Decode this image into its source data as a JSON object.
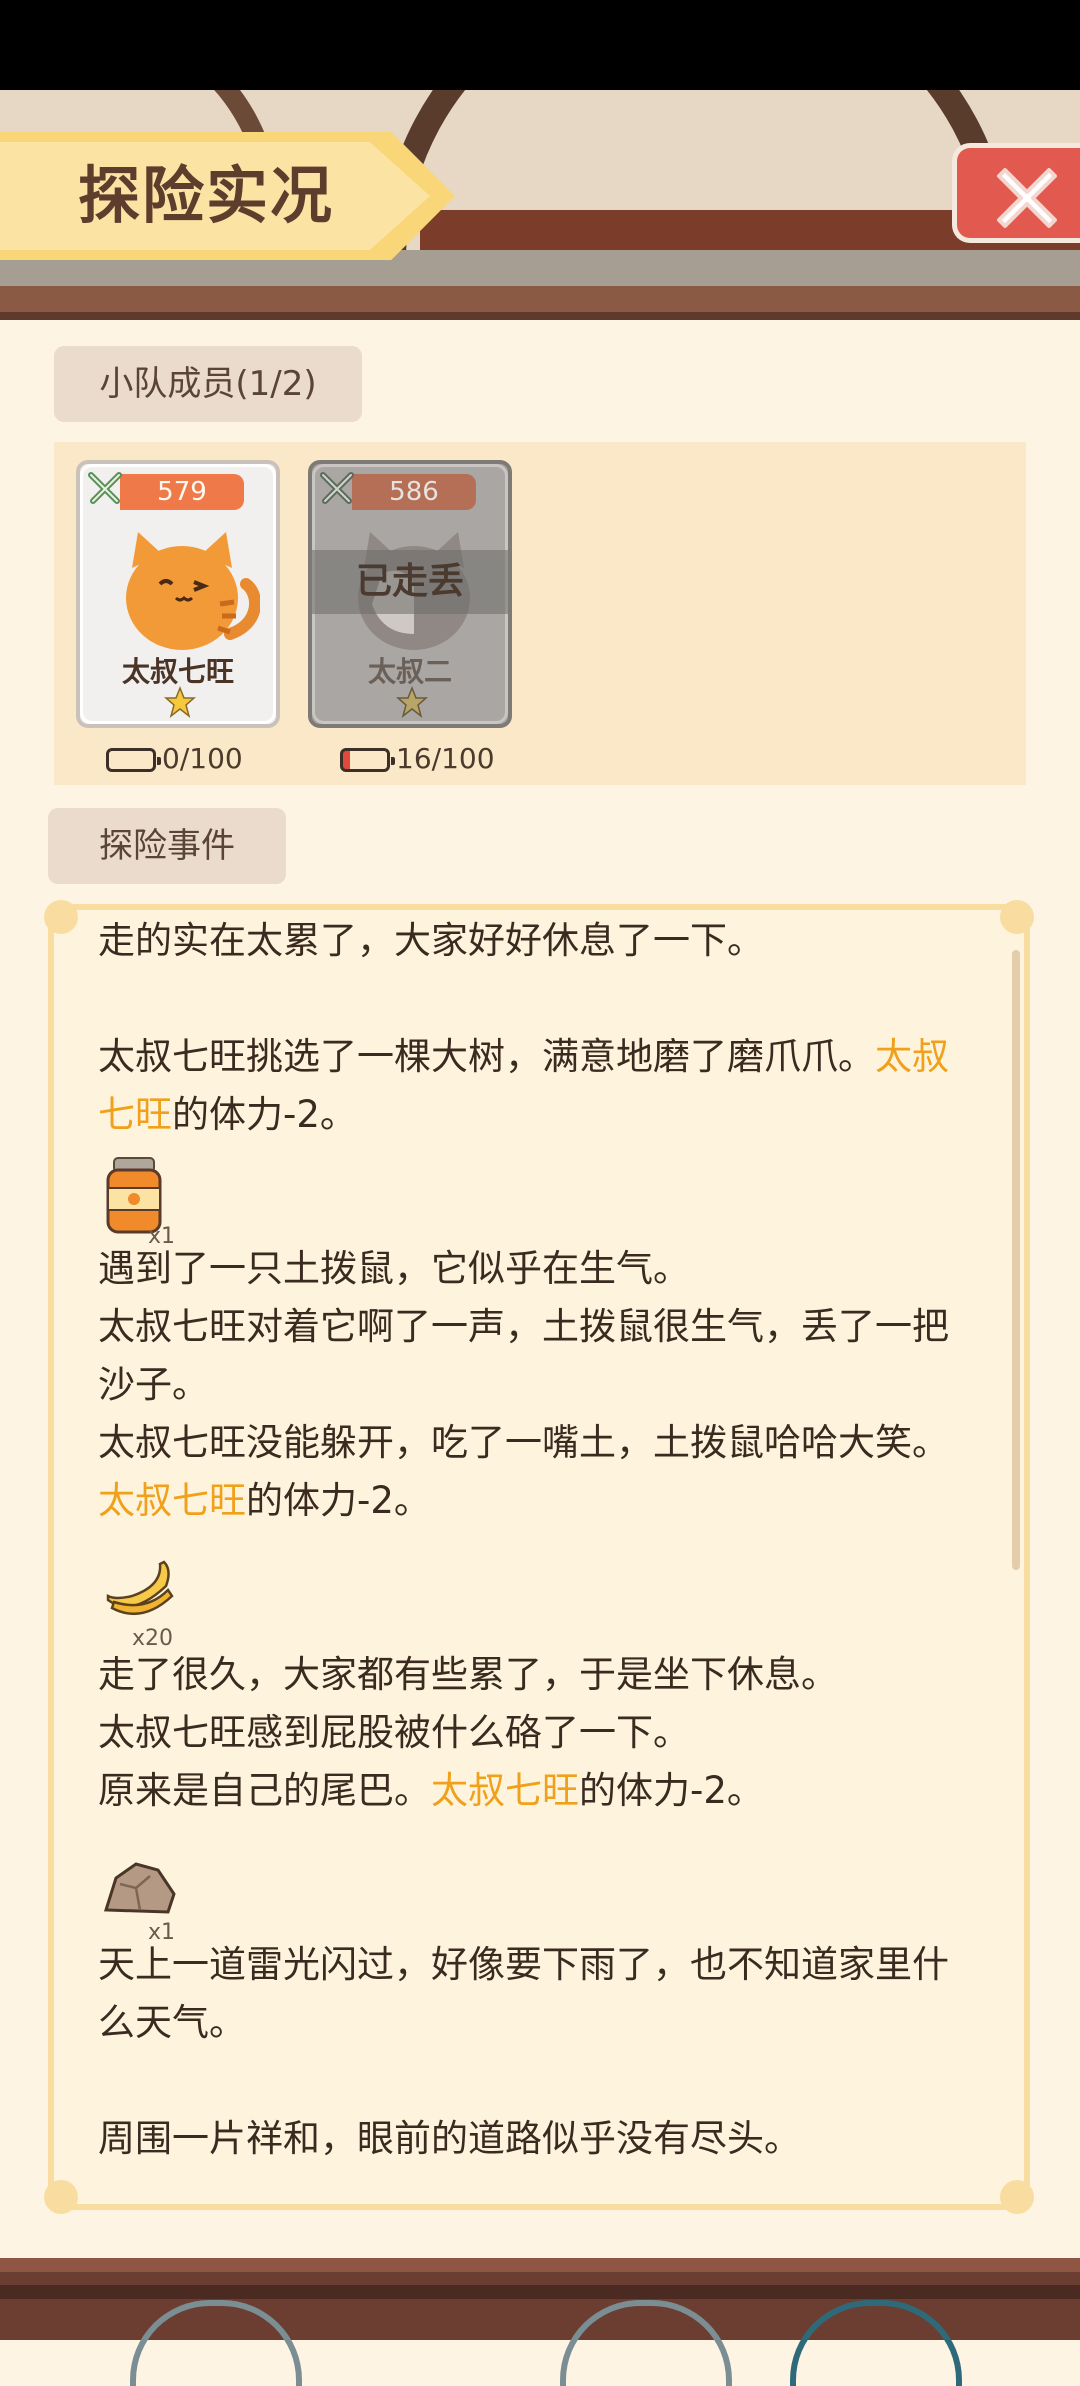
{
  "header": {
    "title": "探险实况"
  },
  "team": {
    "section_label": "小队成员(1/2)",
    "members": [
      {
        "name": "太叔七旺",
        "power": "579",
        "stamina": "0/100",
        "status": "",
        "stars": 1
      },
      {
        "name": "太叔二",
        "power": "586",
        "stamina": "16/100",
        "status": "已走丢",
        "stars": 1
      }
    ]
  },
  "events": {
    "section_label": "探险事件",
    "paragraphs": {
      "e1": "走的实在太累了，大家好好休息了一下。",
      "e2a": "太叔七旺挑选了一棵大树，满意地磨了磨爪爪。",
      "e2hl": "太叔七旺",
      "e2b": "的体力-2。",
      "item1_count": "x1",
      "e3a": "遇到了一只土拨鼠，它似乎在生气。",
      "e3b": "太叔七旺对着它啊了一声，土拨鼠很生气，丢了一把沙子。",
      "e3c": "太叔七旺没能躲开，吃了一嘴土，土拨鼠哈哈大笑。",
      "e3hl": "太叔七旺",
      "e3d": "的体力-2。",
      "item2_count": "x20",
      "e4a": "走了很久，大家都有些累了，于是坐下休息。",
      "e4b": "太叔七旺感到屁股被什么硌了一下。",
      "e4c": "原来是自己的尾巴。",
      "e4hl": "太叔七旺",
      "e4d": "的体力-2。",
      "item3_count": "x1",
      "e5": "天上一道雷光闪过，好像要下雨了，也不知道家里什么天气。",
      "e6": "周围一片祥和，眼前的道路似乎没有尽头。"
    }
  },
  "icons": {
    "close": "close-icon",
    "sword": "crossed-swords-icon",
    "star": "star-icon",
    "battery": "battery-icon",
    "item1": "jar-icon",
    "item2": "banana-icon",
    "item3": "rock-icon"
  },
  "colors": {
    "highlight": "#f0a01a",
    "banner": "#f9d678",
    "close": "#e25a4f",
    "panel": "#fef4dd"
  }
}
